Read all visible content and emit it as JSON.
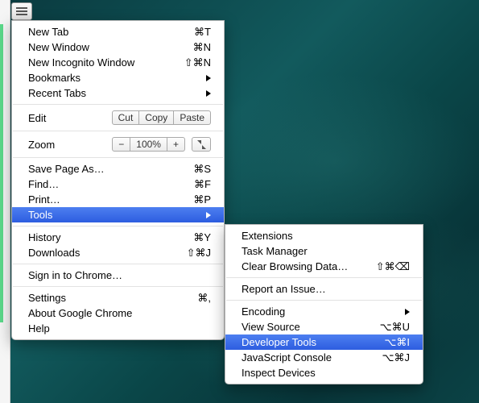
{
  "hamburger": {
    "name": "menu-button"
  },
  "mainMenu": {
    "groups": [
      [
        {
          "label": "New Tab",
          "shortcut": "⌘T"
        },
        {
          "label": "New Window",
          "shortcut": "⌘N"
        },
        {
          "label": "New Incognito Window",
          "shortcut": "⇧⌘N"
        },
        {
          "label": "Bookmarks",
          "submenu": true
        },
        {
          "label": "Recent Tabs",
          "submenu": true
        }
      ],
      [
        {
          "type": "edit",
          "label": "Edit",
          "buttons": {
            "cut": "Cut",
            "copy": "Copy",
            "paste": "Paste"
          }
        }
      ],
      [
        {
          "type": "zoom",
          "label": "Zoom",
          "minus": "−",
          "value": "100%",
          "plus": "+",
          "fullscreen": true
        }
      ],
      [
        {
          "label": "Save Page As…",
          "shortcut": "⌘S"
        },
        {
          "label": "Find…",
          "shortcut": "⌘F"
        },
        {
          "label": "Print…",
          "shortcut": "⌘P"
        },
        {
          "label": "Tools",
          "submenu": true,
          "selected": true
        }
      ],
      [
        {
          "label": "History",
          "shortcut": "⌘Y"
        },
        {
          "label": "Downloads",
          "shortcut": "⇧⌘J"
        }
      ],
      [
        {
          "label": "Sign in to Chrome…"
        }
      ],
      [
        {
          "label": "Settings",
          "shortcut": "⌘,"
        },
        {
          "label": "About Google Chrome"
        },
        {
          "label": "Help"
        }
      ]
    ]
  },
  "subMenu": {
    "groups": [
      [
        {
          "label": "Extensions"
        },
        {
          "label": "Task Manager"
        },
        {
          "label": "Clear Browsing Data…",
          "shortcut": "⇧⌘⌫"
        }
      ],
      [
        {
          "label": "Report an Issue…"
        }
      ],
      [
        {
          "label": "Encoding",
          "submenu": true
        },
        {
          "label": "View Source",
          "shortcut": "⌥⌘U"
        },
        {
          "label": "Developer Tools",
          "shortcut": "⌥⌘I",
          "selected": true
        },
        {
          "label": "JavaScript Console",
          "shortcut": "⌥⌘J"
        },
        {
          "label": "Inspect Devices"
        }
      ]
    ]
  }
}
